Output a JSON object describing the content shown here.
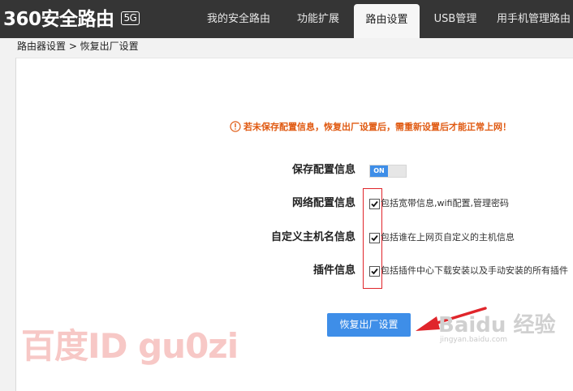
{
  "header": {
    "logo_text": "360安全路由",
    "logo_badge": "5G",
    "tabs": [
      {
        "label": "我的安全路由"
      },
      {
        "label": "功能扩展"
      },
      {
        "label": "路由设置"
      },
      {
        "label": "USB管理"
      },
      {
        "label": "用手机管理路由"
      }
    ],
    "active_tab": "路由设置"
  },
  "breadcrumb": "路由器设置 > 恢复出厂设置",
  "main": {
    "warning": "若未保存配置信息，恢复出厂设置后，需重新设置后才能正常上网！",
    "save_config": {
      "label": "保存配置信息",
      "toggle_text": "ON",
      "toggle_on": true
    },
    "options": [
      {
        "label": "网络配置信息",
        "desc": "包括宽带信息,wifi配置,管理密码",
        "checked": true
      },
      {
        "label": "自定义主机名信息",
        "desc": "包括谁在上网页自定义的主机信息",
        "checked": true
      },
      {
        "label": "插件信息",
        "desc": "包括插件中心下载安装以及手动安装的所有插件",
        "checked": true
      }
    ],
    "reset_button": "恢复出厂设置"
  },
  "overlays": {
    "watermark": "百度ID gu0zi",
    "baidu_logo": "Baidu 经验",
    "baidu_url": "jingyan.baidu.com"
  },
  "colors": {
    "topbar": "#353535",
    "accent": "#3e8ee8",
    "warning": "#e05a12",
    "highlight": "#e0252b"
  }
}
